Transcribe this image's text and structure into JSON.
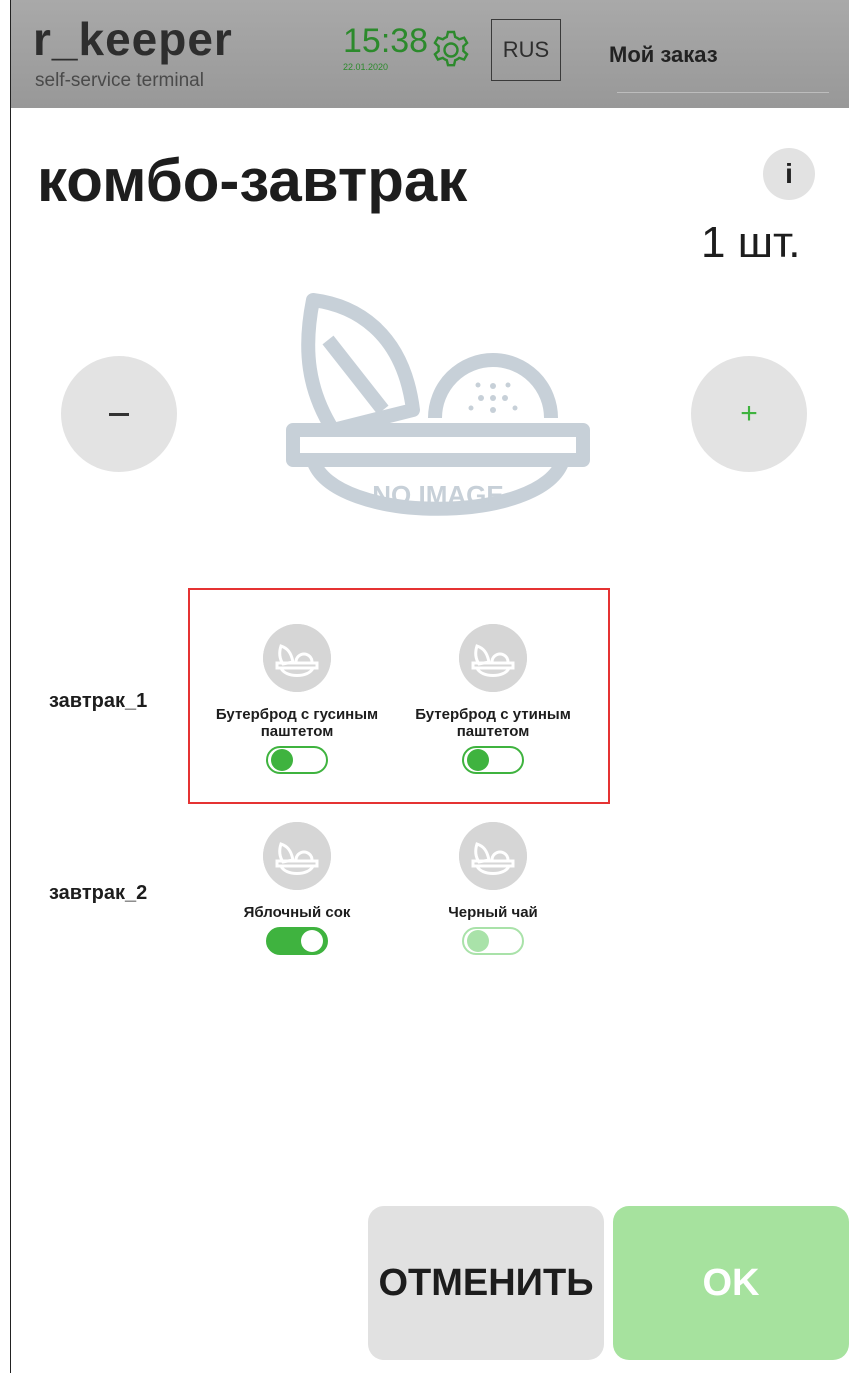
{
  "header": {
    "logo": "r_keeper",
    "logo_sub": "self-service terminal",
    "time": "15:38",
    "date": "22.01.2020",
    "language": "RUS",
    "order_link": "Мой заказ"
  },
  "product": {
    "title": "комбо-завтрак",
    "info_label": "i",
    "quantity": "1 шт.",
    "minus_label": "–",
    "plus_label": "+",
    "image_placeholder": "NO IMAGE"
  },
  "groups": [
    {
      "label": "завтрак_1",
      "items": [
        {
          "name_line1": "Бутерброд с гусиным",
          "name_line2": "паштетом",
          "state": "off"
        },
        {
          "name_line1": "Бутерброд с утиным",
          "name_line2": "паштетом",
          "state": "off"
        }
      ]
    },
    {
      "label": "завтрак_2",
      "items": [
        {
          "name_line1": "Яблочный сок",
          "name_line2": "",
          "state": "on"
        },
        {
          "name_line1": "Черный чай",
          "name_line2": "",
          "state": "disabled"
        }
      ]
    }
  ],
  "footer": {
    "cancel_label": "ОТМЕНИТЬ",
    "ok_label": "OK"
  },
  "colors": {
    "accent_green": "#3fb33f",
    "ok_green": "#a6e29e",
    "time_green": "#2c8a2c",
    "highlight_red": "#e53333",
    "topbar_gray": "#a3a3a3"
  }
}
